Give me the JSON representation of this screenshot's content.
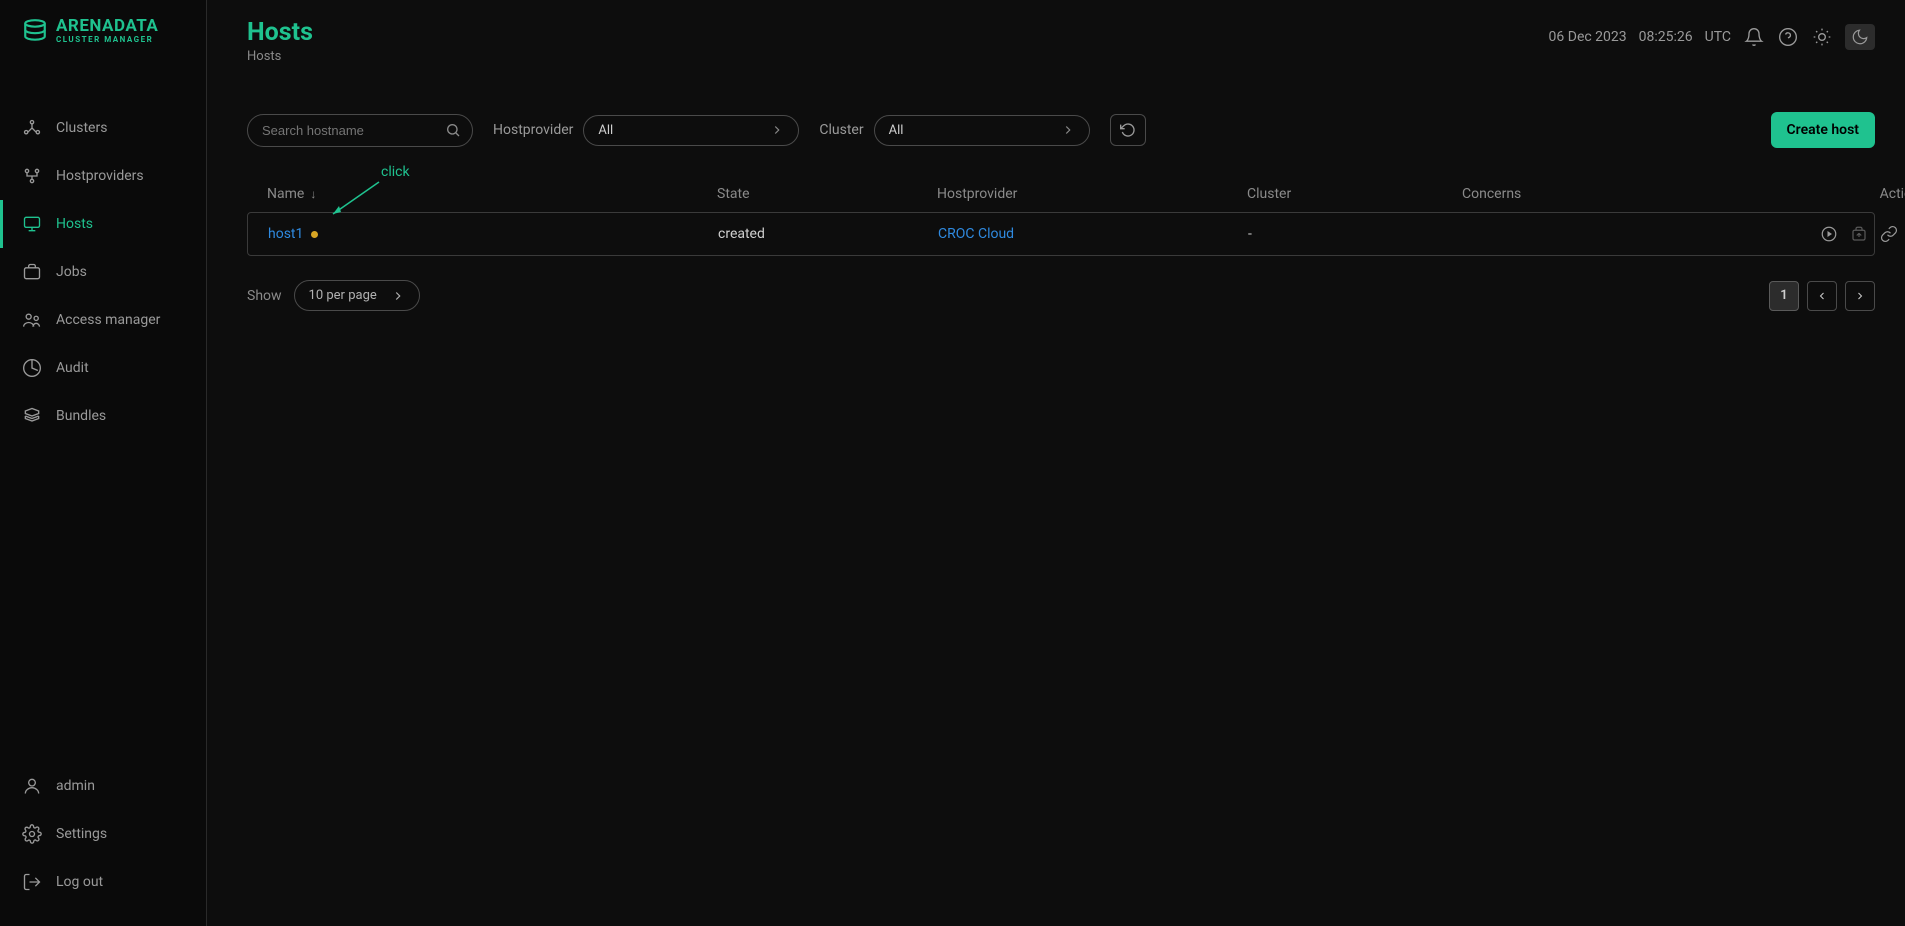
{
  "brand": {
    "title": "ARENADATA",
    "subtitle": "CLUSTER MANAGER"
  },
  "sidebar": {
    "items": [
      {
        "label": "Clusters"
      },
      {
        "label": "Hostproviders"
      },
      {
        "label": "Hosts"
      },
      {
        "label": "Jobs"
      },
      {
        "label": "Access manager"
      },
      {
        "label": "Audit"
      },
      {
        "label": "Bundles"
      }
    ],
    "footer": [
      {
        "label": "admin"
      },
      {
        "label": "Settings"
      },
      {
        "label": "Log out"
      }
    ]
  },
  "header": {
    "title": "Hosts",
    "breadcrumb": "Hosts",
    "date": "06 Dec 2023",
    "time": "08:25:26",
    "tz": "UTC"
  },
  "toolbar": {
    "search_placeholder": "Search hostname",
    "filter_hp_label": "Hostprovider",
    "filter_hp_value": "All",
    "filter_cluster_label": "Cluster",
    "filter_cluster_value": "All",
    "create_label": "Create host"
  },
  "table": {
    "columns": {
      "name": "Name",
      "state": "State",
      "hostprovider": "Hostprovider",
      "cluster": "Cluster",
      "concerns": "Concerns",
      "actions": "Actions"
    },
    "rows": [
      {
        "name": "host1",
        "state": "created",
        "hostprovider": "CROC Cloud",
        "cluster": "-",
        "concerns": ""
      }
    ]
  },
  "annotation": {
    "label": "click"
  },
  "footer": {
    "show_label": "Show",
    "per_page": "10 per page",
    "current_page": "1"
  }
}
